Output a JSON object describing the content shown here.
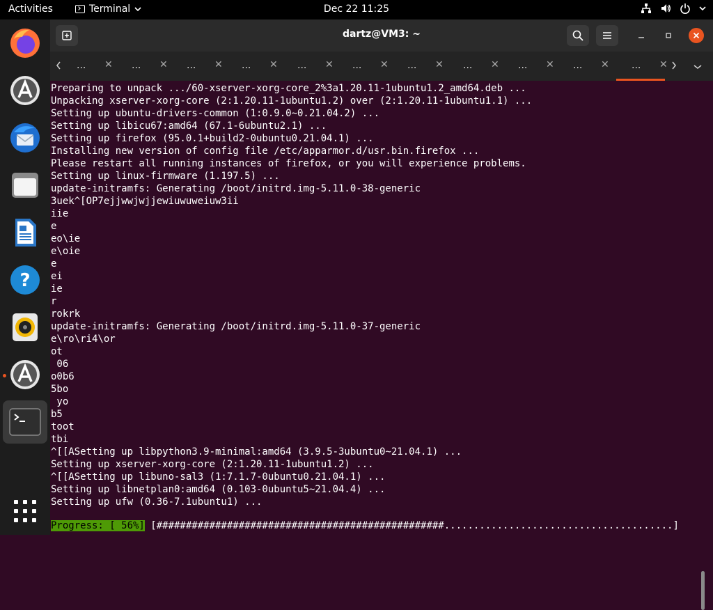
{
  "topbar": {
    "activities": "Activities",
    "app_name": "Terminal",
    "clock": "Dec 22  11:25"
  },
  "dock": {
    "items": [
      "firefox",
      "software-updater",
      "thunderbird",
      "files",
      "libreoffice-writer",
      "help",
      "rhythmbox",
      "software-updater-running",
      "terminal",
      "show-applications"
    ]
  },
  "window": {
    "title": "dartz@VM3: ~"
  },
  "tabs": {
    "labels": [
      "...",
      "...",
      "...",
      "...",
      "...",
      "...",
      "...",
      "...",
      "...",
      "...",
      "..."
    ],
    "close_glyph": "✕",
    "active_index": 10
  },
  "terminal": {
    "lines": [
      "Preparing to unpack .../60-xserver-xorg-core_2%3a1.20.11-1ubuntu1.2_amd64.deb ...",
      "Unpacking xserver-xorg-core (2:1.20.11-1ubuntu1.2) over (2:1.20.11-1ubuntu1.1) ...",
      "Setting up ubuntu-drivers-common (1:0.9.0~0.21.04.2) ...",
      "Setting up libicu67:amd64 (67.1-6ubuntu2.1) ...",
      "Setting up firefox (95.0.1+build2-0ubuntu0.21.04.1) ...",
      "Installing new version of config file /etc/apparmor.d/usr.bin.firefox ...",
      "Please restart all running instances of firefox, or you will experience problems.",
      "Setting up linux-firmware (1.197.5) ...",
      "update-initramfs: Generating /boot/initrd.img-5.11.0-38-generic",
      "3uek^[OP7ejjwwjwjjewiuwuweiuw3ii",
      "iie",
      "e",
      "eo\\ie",
      "e\\oie",
      "e",
      "ei",
      "ie",
      "r",
      "rokrk",
      "update-initramfs: Generating /boot/initrd.img-5.11.0-37-generic",
      "e\\ro\\ri4\\or",
      "ot",
      " 06",
      "o0b6",
      "5bo",
      " yo",
      "b5",
      "toot",
      "tbi",
      "^[[ASetting up libpython3.9-minimal:amd64 (3.9.5-3ubuntu0~21.04.1) ...",
      "Setting up xserver-xorg-core (2:1.20.11-1ubuntu1.2) ...",
      "^[[ASetting up libuno-sal3 (1:7.1.7-0ubuntu0.21.04.1) ...",
      "Setting up libnetplan0:amd64 (0.103-0ubuntu5~21.04.4) ...",
      "Setting up ufw (0.36-7.1ubuntu1) ..."
    ],
    "progress_label": "Progress: [ 56%]",
    "progress_bar": " [#################################################.......................................]",
    "progress_percent": 56
  }
}
